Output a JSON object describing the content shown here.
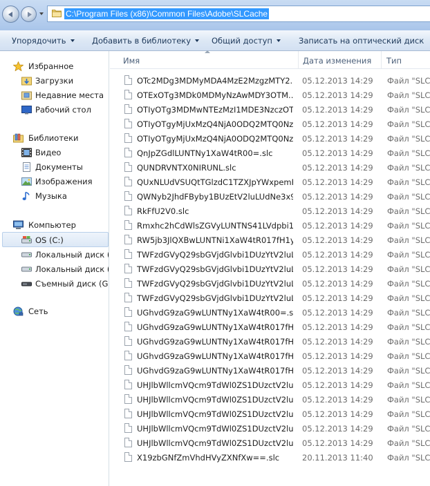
{
  "address": {
    "path": "C:\\Program Files (x86)\\Common Files\\Adobe\\SLCache"
  },
  "toolbar": {
    "organize": "Упорядочить",
    "add_to_library": "Добавить в библиотеку",
    "share": "Общий доступ",
    "burn": "Записать на оптический диск"
  },
  "nav": {
    "favorites": "Избранное",
    "downloads": "Загрузки",
    "recent": "Недавние места",
    "desktop": "Рабочий стол",
    "libraries": "Библиотеки",
    "video": "Видео",
    "documents": "Документы",
    "images": "Изображения",
    "music": "Музыка",
    "computer": "Компьютер",
    "os_c": "OS (C:)",
    "local_d": "Локальный диск (D",
    "local_f": "Локальный диск (F:",
    "removable_g": "Съемный диск (G:)",
    "network": "Сеть"
  },
  "columns": {
    "name": "Имя",
    "date": "Дата изменения",
    "type": "Тип"
  },
  "files": [
    {
      "name": "OTc2MDg3MDMyMDA4MzE2MzgzMTY2...",
      "date": "05.12.2013 14:29",
      "type": "Файл \"SLC\""
    },
    {
      "name": "OTExOTg3MDk0MDMyNzAwMDY3OTM...",
      "date": "05.12.2013 14:29",
      "type": "Файл \"SLC\""
    },
    {
      "name": "OTIyOTg3MDMwNTEzMzI1MDE3NzczOT...",
      "date": "05.12.2013 14:29",
      "type": "Файл \"SLC\""
    },
    {
      "name": "OTIyOTgyMjUxMzQ4NjA0ODQ2MTQ0Nz...",
      "date": "05.12.2013 14:29",
      "type": "Файл \"SLC\""
    },
    {
      "name": "OTIyOTgyMjUxMzQ4NjA0ODQ2MTQ0Nz...",
      "date": "05.12.2013 14:29",
      "type": "Файл \"SLC\""
    },
    {
      "name": "QnJpZGdlLUNTNy1XaW4tR00=.slc",
      "date": "05.12.2013 14:29",
      "type": "Файл \"SLC\""
    },
    {
      "name": "QUNDRVNTX0NIRUNL.slc",
      "date": "05.12.2013 14:29",
      "type": "Файл \"SLC\""
    },
    {
      "name": "QUxNLUdVSUQtTGlzdC1TZXJpYWxpemF...",
      "date": "05.12.2013 14:29",
      "type": "Файл \"SLC\""
    },
    {
      "name": "QWNyb2JhdFByby1BUzEtV2luLUdNe3x9c...",
      "date": "05.12.2013 14:29",
      "type": "Файл \"SLC\""
    },
    {
      "name": "RkFfU2V0.slc",
      "date": "05.12.2013 14:29",
      "type": "Файл \"SLC\""
    },
    {
      "name": "Rmxhc2hCdWlsZGVyLUNTNS41LVdpbi1...",
      "date": "05.12.2013 14:29",
      "type": "Файл \"SLC\""
    },
    {
      "name": "RW5jb3JlQXBwLUNTNi1XaW4tR017fH1y...",
      "date": "05.12.2013 14:29",
      "type": "Файл \"SLC\""
    },
    {
      "name": "TWFzdGVyQ29sbGVjdGlvbi1DUzYtV2luLU...",
      "date": "05.12.2013 14:29",
      "type": "Файл \"SLC\""
    },
    {
      "name": "TWFzdGVyQ29sbGVjdGlvbi1DUzYtV2luLU...",
      "date": "05.12.2013 14:29",
      "type": "Файл \"SLC\""
    },
    {
      "name": "TWFzdGVyQ29sbGVjdGlvbi1DUzYtV2luLU...",
      "date": "05.12.2013 14:29",
      "type": "Файл \"SLC\""
    },
    {
      "name": "TWFzdGVyQ29sbGVjdGlvbi1DUzYtV2luLU...",
      "date": "05.12.2013 14:29",
      "type": "Файл \"SLC\""
    },
    {
      "name": "UGhvdG9zaG9wLUNTNy1XaW4tR00=.slc",
      "date": "05.12.2013 14:29",
      "type": "Файл \"SLC\""
    },
    {
      "name": "UGhvdG9zaG9wLUNTNy1XaW4tR017fH0...",
      "date": "05.12.2013 14:29",
      "type": "Файл \"SLC\""
    },
    {
      "name": "UGhvdG9zaG9wLUNTNy1XaW4tR017fH1...",
      "date": "05.12.2013 14:29",
      "type": "Файл \"SLC\""
    },
    {
      "name": "UGhvdG9zaG9wLUNTNy1XaW4tR017fH1...",
      "date": "05.12.2013 14:29",
      "type": "Файл \"SLC\""
    },
    {
      "name": "UGhvdG9zaG9wLUNTNy1XaW4tR017fH1...",
      "date": "05.12.2013 14:29",
      "type": "Файл \"SLC\""
    },
    {
      "name": "UHJlbWllcmVQcm9TdWl0ZS1DUzctV2luLU...",
      "date": "05.12.2013 14:29",
      "type": "Файл \"SLC\""
    },
    {
      "name": "UHJlbWllcmVQcm9TdWl0ZS1DUzctV2luLU...",
      "date": "05.12.2013 14:29",
      "type": "Файл \"SLC\""
    },
    {
      "name": "UHJlbWllcmVQcm9TdWl0ZS1DUzctV2luLU...",
      "date": "05.12.2013 14:29",
      "type": "Файл \"SLC\""
    },
    {
      "name": "UHJlbWllcmVQcm9TdWl0ZS1DUzctV2luLU...",
      "date": "05.12.2013 14:29",
      "type": "Файл \"SLC\""
    },
    {
      "name": "UHJlbWllcmVQcm9TdWl0ZS1DUzctV2luLU...",
      "date": "05.12.2013 14:29",
      "type": "Файл \"SLC\""
    },
    {
      "name": "X19zbGNfZmVhdHVyZXNfXw==.slc",
      "date": "20.11.2013 11:40",
      "type": "Файл \"SLC\""
    }
  ]
}
